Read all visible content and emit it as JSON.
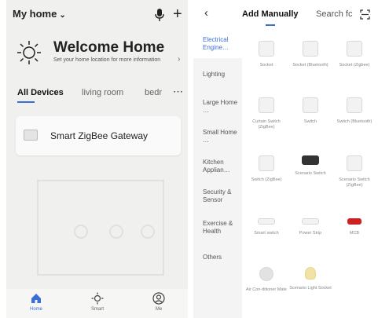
{
  "left": {
    "home_title": "My home",
    "welcome_title": "Welcome Home",
    "welcome_sub": "Set your home location for more information",
    "tabs": [
      "All Devices",
      "living room",
      "bedr"
    ],
    "device_name": "Smart ZigBee Gateway",
    "nav": [
      "Home",
      "Smart",
      "Me"
    ]
  },
  "right": {
    "tab_active": "Add Manually",
    "tab_inactive": "Search fc",
    "categories": [
      "Electrical Engine…",
      "Lighting",
      "Large Home …",
      "Small Home …",
      "Kitchen Applian…",
      "Security & Sensor",
      "Exercise & Health",
      "Others"
    ],
    "devices": [
      "Socket",
      "Socket (Bluetooth)",
      "Socket (Zigbee)",
      "Curtain Switch (ZigBee)",
      "Switch",
      "Switch (Bluetooth)",
      "Switch (ZigBee)",
      "Scenario Switch",
      "Scenario Switch (ZigBee)",
      "Smart switch",
      "Power Strip",
      "MCB",
      "Air Con-ditioner Mate",
      "Scenario Light Socket"
    ]
  },
  "colors": {
    "accent": "#3a6fd8",
    "mcb_red": "#c22222"
  },
  "icons": [
    "microphone-icon",
    "plus-icon",
    "sun-icon",
    "more-icon",
    "gateway-icon",
    "home-icon",
    "smart-icon",
    "me-icon",
    "back-icon",
    "scan-icon"
  ]
}
